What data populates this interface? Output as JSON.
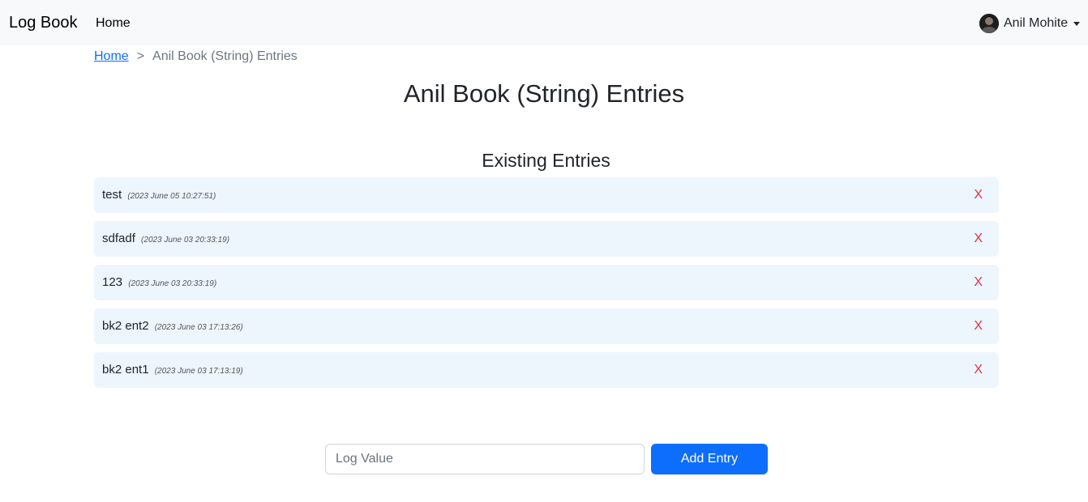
{
  "navbar": {
    "brand": "Log Book",
    "home_link": "Home",
    "user_name": "Anil Mohite"
  },
  "breadcrumb": {
    "home": "Home",
    "separator": ">",
    "current": "Anil Book (String) Entries"
  },
  "page": {
    "title": "Anil Book (String) Entries",
    "section_title": "Existing Entries"
  },
  "entries": [
    {
      "value": "test",
      "timestamp": "(2023 June 05 10:27:51)",
      "delete_label": "X"
    },
    {
      "value": "sdfadf",
      "timestamp": "(2023 June 03 20:33:19)",
      "delete_label": "X"
    },
    {
      "value": "123",
      "timestamp": "(2023 June 03 20:33:19)",
      "delete_label": "X"
    },
    {
      "value": "bk2 ent2",
      "timestamp": "(2023 June 03 17:13:26)",
      "delete_label": "X"
    },
    {
      "value": "bk2 ent1",
      "timestamp": "(2023 June 03 17:13:19)",
      "delete_label": "X"
    }
  ],
  "form": {
    "input_value": "",
    "input_placeholder": "Log Value",
    "add_button": "Add Entry"
  },
  "colors": {
    "navbar_bg": "#f8f9fa",
    "entry_bg": "#edf5fd",
    "primary": "#0d6efd",
    "delete": "#dc3545",
    "link": "#0d6efd"
  },
  "icons": {
    "avatar": "user-avatar-photo",
    "dropdown": "caret-down-icon"
  }
}
